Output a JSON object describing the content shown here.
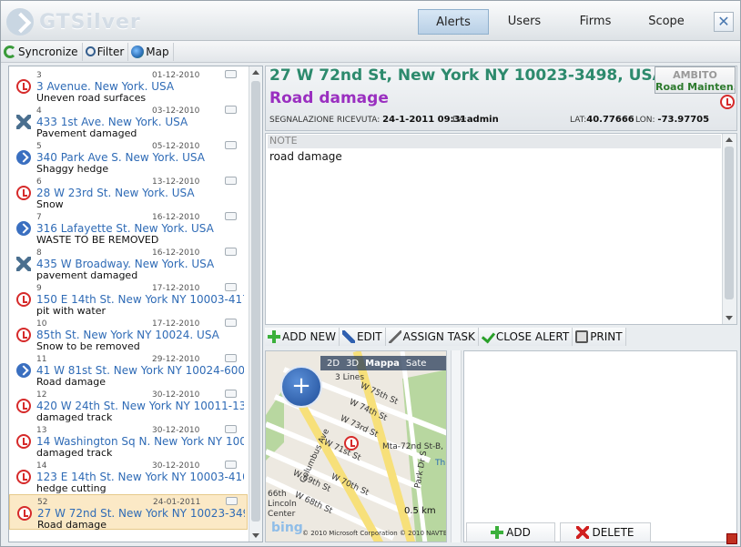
{
  "app": {
    "title": "GTSilver"
  },
  "nav": {
    "tabs": [
      {
        "label": "Alerts",
        "active": true
      },
      {
        "label": "Users"
      },
      {
        "label": "Firms"
      },
      {
        "label": "Scope"
      }
    ]
  },
  "toolbar": {
    "syncronize": "Syncronize",
    "filter": "Filter",
    "map": "Map"
  },
  "alerts": [
    {
      "id": "3",
      "date": "01-12-2010",
      "address": "3 Avenue. New York. USA",
      "description": "Uneven road surfaces",
      "icon": "alarm-icon"
    },
    {
      "id": "4",
      "date": "03-12-2010",
      "address": "433 1st Ave. New York. USA",
      "description": "Pavement damaged",
      "icon": "wrench-icon"
    },
    {
      "id": "5",
      "date": "05-12-2010",
      "address": "340 Park Ave S. New York. USA",
      "description": "Shaggy hedge",
      "icon": "forward-icon"
    },
    {
      "id": "6",
      "date": "13-12-2010",
      "address": "28 W 23rd St. New York. USA",
      "description": "Snow",
      "icon": "alarm-icon"
    },
    {
      "id": "7",
      "date": "16-12-2010",
      "address": "316 Lafayette St. New York. USA",
      "description": "WASTE TO BE REMOVED",
      "icon": "forward-icon"
    },
    {
      "id": "8",
      "date": "16-12-2010",
      "address": "435 W Broadway. New York. USA",
      "description": "pavement damaged",
      "icon": "wrench-icon"
    },
    {
      "id": "9",
      "date": "17-12-2010",
      "address": "150 E 14th St.  New York  NY 10003-417",
      "description": "pit with water",
      "icon": "alarm-icon"
    },
    {
      "id": "10",
      "date": "17-12-2010",
      "address": "85th St. New York  NY 10024. USA",
      "description": "Snow to be removed",
      "icon": "alarm-icon"
    },
    {
      "id": "11",
      "date": "29-12-2010",
      "address": "41 W 81st St. New York  NY 10024-6001",
      "description": "Road damage",
      "icon": "forward-icon"
    },
    {
      "id": "12",
      "date": "30-12-2010",
      "address": "420 W 24th St. New York  NY 10011-13",
      "description": "damaged track",
      "icon": "alarm-icon"
    },
    {
      "id": "13",
      "date": "30-12-2010",
      "address": "14 Washington Sq N. New York  NY 1001",
      "description": "damaged track",
      "icon": "alarm-icon"
    },
    {
      "id": "14",
      "date": "30-12-2010",
      "address": "123 E 14th St. New York  NY 10003-410",
      "description": "hedge cutting",
      "icon": "alarm-icon"
    },
    {
      "id": "52",
      "date": "24-01-2011",
      "address": "27 W 72nd St. New York NY 10023-3498",
      "description": "Road damage",
      "icon": "alarm-icon",
      "selected": true
    }
  ],
  "detail": {
    "address": "27 W 72nd St, New York NY 10023-3498, USA",
    "category": "Road damage",
    "received_label": "SEGNALAZIONE RICEVUTA:",
    "received_value": "24-1-2011 09:31",
    "from_label": "DA:",
    "from_value": "admin",
    "lat_label": "LAT:",
    "lat_value": "40.77666",
    "lon_label": "LON:",
    "lon_value": "-73.97705",
    "ambito_label": "AMBITO",
    "ambito_value": "Road Mainten."
  },
  "notes": {
    "header": "NOTE",
    "text": "road damage"
  },
  "actions": {
    "add_new": "ADD NEW",
    "edit": "EDIT",
    "assign_task": "ASSIGN TASK",
    "close_alert": "CLOSE ALERT",
    "print": "PRINT"
  },
  "map": {
    "mode_2d": "2D",
    "mode_3d": "3D",
    "mode_map": "Mappa",
    "mode_sat": "Sate",
    "labels": [
      "3 Lines",
      "W 75th St",
      "W 74th St",
      "W 73rd St",
      "Columbus Ave",
      "W 71st St",
      "Mta-72nd St-B,",
      "W 70th St",
      "W 69th St",
      "W 68th St",
      "66th",
      "Lincoln",
      "Center",
      "Park Dr S",
      "Th"
    ],
    "scale": "0.5 km",
    "brand": "bing",
    "copyright": "© 2010 Microsoft Corporation   © 2010 NAVTEQ  © AND"
  },
  "side": {
    "add": "ADD",
    "delete": "DELETE"
  }
}
